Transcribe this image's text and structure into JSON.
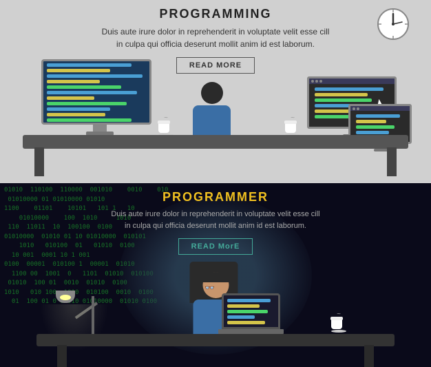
{
  "topBanner": {
    "title": "PROGRAMMING",
    "subtitle": "Duis aute irure dolor in reprehenderit in voluptate velit esse cill\nin culpa qui officia deserunt mollit anim id est laborum.",
    "readMoreBtn": "READ MORE"
  },
  "bottomBanner": {
    "title": "PROGRAMMER",
    "subtitle": "Duis aute irure dolor in reprehenderit in voluptate velit esse cill\nin culpa qui officia deserunt mollit anim id est laborum.",
    "readMoreBtn": "READ MorE",
    "binaryText": "01010  110100  110000  001010    0010    010\n 01010000 01 01010000 01010\n1100    01101    10101   101 1   10\n    01010000    100  1010     1010\n 110  11011  10  100100  0100\n01010000  01010 01 10 01010000  010101\n    1010   010100  01   01010  0100\n  10 001  0001 10 1 001\n0100  00001  010100 1  00001  01010\n  1100 00  1001  0   1101  01010  010100\n 01010  100 01  0010  01010  0100\n1010   010 100  1010  010100  0010  0100\n  01  100 01 0 01010 01010000  01010 0100"
  }
}
